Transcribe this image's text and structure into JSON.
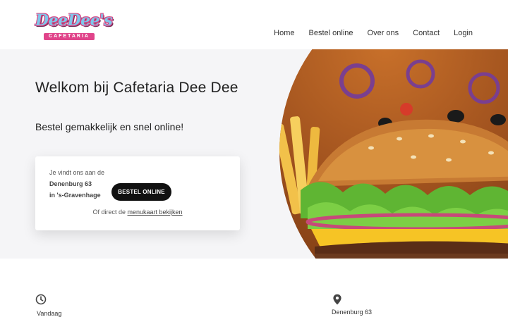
{
  "header": {
    "logo_main": "DeeDee's",
    "logo_sub": "CAFETARIA",
    "nav": [
      {
        "label": "Home",
        "icon": null
      },
      {
        "label": "Bestel online",
        "icon": null
      },
      {
        "label": "Over ons",
        "icon": null
      },
      {
        "label": "Contact",
        "icon": null
      },
      {
        "label": "Login",
        "icon": null
      }
    ]
  },
  "hero": {
    "title": "Welkom bij Cafetaria Dee Dee",
    "subtitle": "Bestel gemakkelijk en snel online!",
    "card": {
      "intro": "Je vindt ons aan de",
      "street": "Denenburg 63",
      "city": "in 's-Gravenhage",
      "order_button": "BESTEL ONLINE",
      "menu_prefix": "Of direct de",
      "menu_link": "menukaart bekijken"
    },
    "image_icon": "burger-food-photo"
  },
  "info": {
    "hours_icon": "clock-icon",
    "hours_label": "Vandaag",
    "location_icon": "map-pin-icon",
    "address": "Denenburg 63"
  },
  "colors": {
    "accent": "#111111",
    "hero_bg": "#f5f5f7",
    "logo_pink": "#e0448a",
    "logo_blue": "#7fc6ea"
  }
}
